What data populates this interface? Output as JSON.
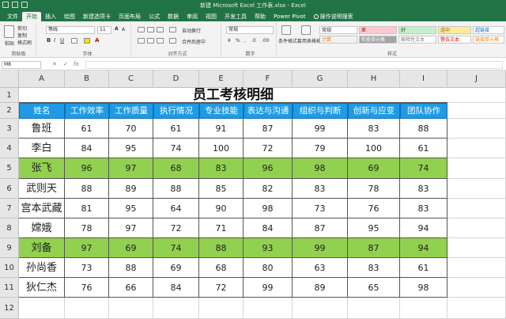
{
  "window": {
    "title": "新建 Microsoft Excel 工作表.xlsx - Excel"
  },
  "tabs": [
    "文件",
    "开始",
    "插入",
    "绘图",
    "新建选项卡",
    "页面布局",
    "公式",
    "数据",
    "审阅",
    "视图",
    "开发工具",
    "帮助",
    "Power Pivot",
    "操作说明搜索"
  ],
  "ribbon": {
    "clipboard": {
      "paste": "粘贴",
      "cut": "剪切",
      "copy": "复制",
      "format_painter": "格式刷",
      "label": "剪贴板"
    },
    "font": {
      "name": "等线",
      "size": "11",
      "label": "字体"
    },
    "alignment": {
      "wrap": "自动换行",
      "merge": "合并后居中",
      "label": "对齐方式"
    },
    "number": {
      "format": "常规",
      "label": "数字"
    },
    "styles": {
      "conditional": "条件格式",
      "table": "套用表格格式",
      "cells": [
        {
          "text": "常规",
          "bg": "#ffffff",
          "fg": "#222222"
        },
        {
          "text": "差",
          "bg": "#ffc7ce",
          "fg": "#9c0006"
        },
        {
          "text": "好",
          "bg": "#c6efce",
          "fg": "#006100"
        },
        {
          "text": "适中",
          "bg": "#ffeb9c",
          "fg": "#9c5700"
        },
        {
          "text": "超链接",
          "bg": "#ffffff",
          "fg": "#0563c1"
        },
        {
          "text": "计算",
          "bg": "#f2f2f2",
          "fg": "#fa7d00"
        },
        {
          "text": "检查单元格",
          "bg": "#a5a5a5",
          "fg": "#ffffff"
        },
        {
          "text": "解释性文本",
          "bg": "#ffffff",
          "fg": "#7f7f7f"
        },
        {
          "text": "警告文本",
          "bg": "#ffffff",
          "fg": "#ff0000"
        },
        {
          "text": "链接单元格",
          "bg": "#ffffff",
          "fg": "#fa7d00"
        }
      ],
      "label": "样式"
    }
  },
  "formula_bar": {
    "name_box": "M8",
    "value": ""
  },
  "sheet": {
    "columns": [
      "A",
      "B",
      "C",
      "D",
      "E",
      "F",
      "G",
      "H",
      "I",
      "J"
    ],
    "rows": [
      "1",
      "2",
      "3",
      "4",
      "5",
      "6",
      "7",
      "8",
      "9",
      "10",
      "11",
      "12"
    ],
    "title": "员工考核明细",
    "headers": [
      "姓名",
      "工作效率",
      "工作质量",
      "执行情况",
      "专业技能",
      "表达与沟通",
      "组织与判断",
      "创新与应变",
      "团队协作"
    ],
    "records": [
      {
        "name": "鲁班",
        "scores": [
          "61",
          "70",
          "61",
          "91",
          "87",
          "99",
          "83",
          "88"
        ],
        "highlight": false
      },
      {
        "name": "李白",
        "scores": [
          "84",
          "95",
          "74",
          "100",
          "72",
          "79",
          "100",
          "61"
        ],
        "highlight": false
      },
      {
        "name": "张飞",
        "scores": [
          "96",
          "97",
          "68",
          "83",
          "96",
          "98",
          "69",
          "74"
        ],
        "highlight": true
      },
      {
        "name": "武则天",
        "scores": [
          "88",
          "89",
          "88",
          "85",
          "82",
          "83",
          "78",
          "83"
        ],
        "highlight": false
      },
      {
        "name": "宫本武藏",
        "scores": [
          "81",
          "95",
          "64",
          "90",
          "98",
          "73",
          "76",
          "83"
        ],
        "highlight": false
      },
      {
        "name": "嫦娥",
        "scores": [
          "78",
          "97",
          "72",
          "71",
          "84",
          "87",
          "95",
          "94"
        ],
        "highlight": false
      },
      {
        "name": "刘备",
        "scores": [
          "97",
          "69",
          "74",
          "88",
          "93",
          "99",
          "87",
          "94"
        ],
        "highlight": true
      },
      {
        "name": "孙尚香",
        "scores": [
          "73",
          "88",
          "69",
          "68",
          "80",
          "63",
          "83",
          "61"
        ],
        "highlight": false
      },
      {
        "name": "狄仁杰",
        "scores": [
          "76",
          "66",
          "84",
          "72",
          "99",
          "89",
          "65",
          "98"
        ],
        "highlight": false
      }
    ]
  }
}
